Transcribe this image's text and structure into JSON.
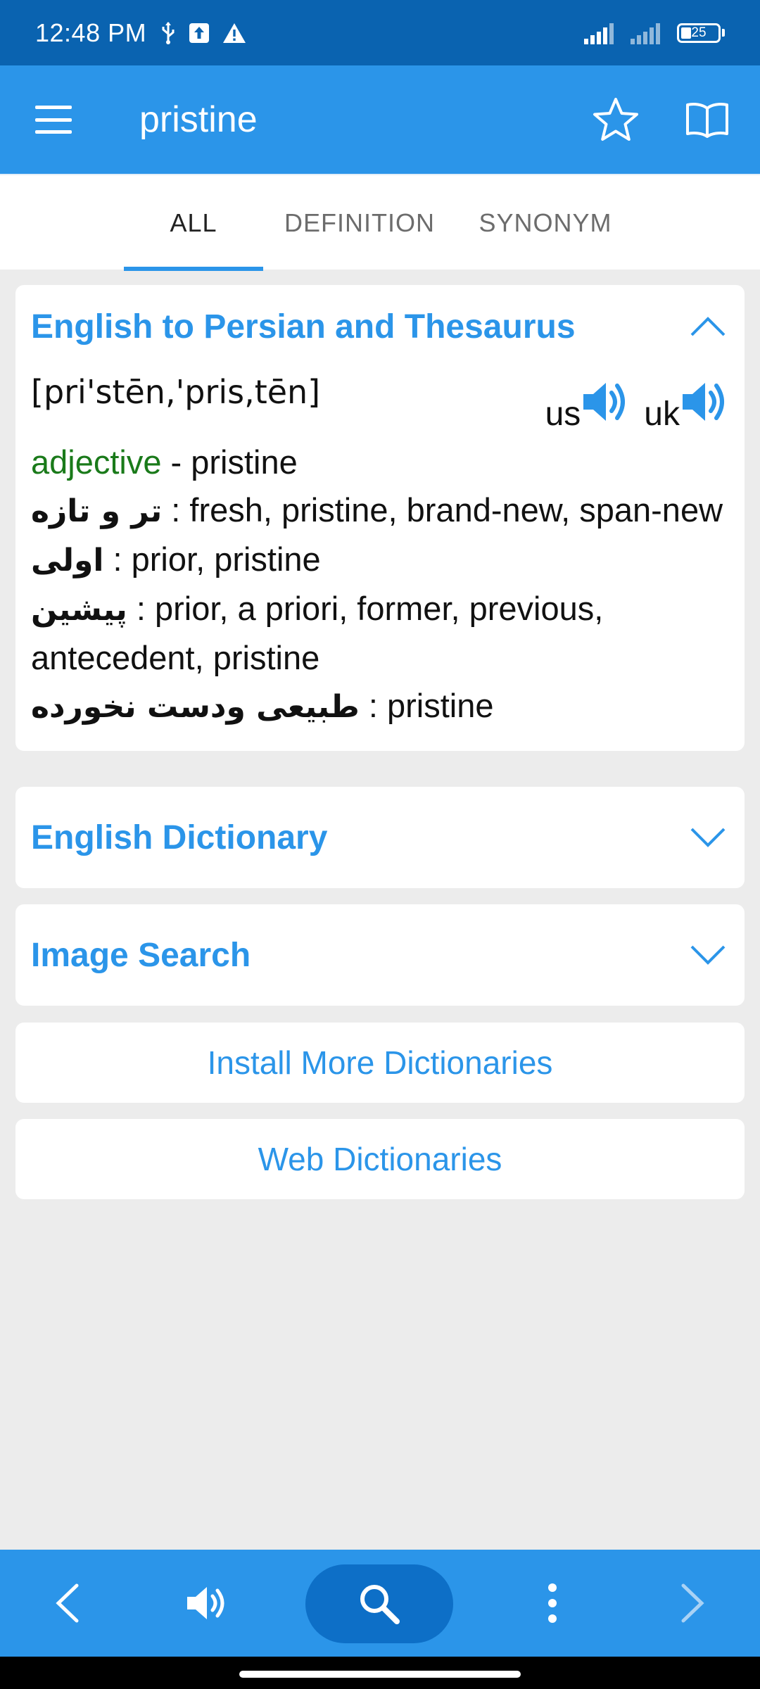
{
  "status_bar": {
    "time": "12:48 PM",
    "battery": "25"
  },
  "app_bar": {
    "title": "pristine"
  },
  "tabs": [
    {
      "label": "ALL",
      "active": true
    },
    {
      "label": "DEFINITION",
      "active": false
    },
    {
      "label": "SYNONYM",
      "active": false
    }
  ],
  "sections": {
    "persian": {
      "title": "English to Persian and Thesaurus",
      "expanded": true,
      "pronunciation": "[pri'stēn,'pris,tēn]",
      "audio": [
        {
          "label": "us"
        },
        {
          "label": "uk"
        }
      ],
      "pos": "adjective",
      "pos_suffix": " - pristine",
      "entries": [
        {
          "fa": "تر و تازه",
          "en": " : fresh, pristine, brand-new, span-new"
        },
        {
          "fa": "اولی",
          "en": " : prior, pristine"
        },
        {
          "fa": "پیشین",
          "en": " : prior, a priori, former, previous, antecedent, pristine"
        },
        {
          "fa": "طبیعی ودست نخورده",
          "en": " : pristine"
        }
      ]
    },
    "english": {
      "title": "English Dictionary",
      "expanded": false
    },
    "image": {
      "title": "Image Search",
      "expanded": false
    }
  },
  "buttons": {
    "install": "Install More Dictionaries",
    "web": "Web Dictionaries"
  },
  "icons": {
    "menu": "menu-icon",
    "favorite": "star-icon",
    "book": "book-icon",
    "back": "chevron-left-icon",
    "speak": "speaker-icon",
    "search": "search-icon",
    "more": "more-vert-icon",
    "forward": "chevron-right-icon"
  },
  "colors": {
    "primary": "#2b95e9",
    "status_bar": "#0a63b0",
    "search_pill": "#0d6fc7",
    "pos": "#1a7a1a",
    "background": "#ececec"
  }
}
